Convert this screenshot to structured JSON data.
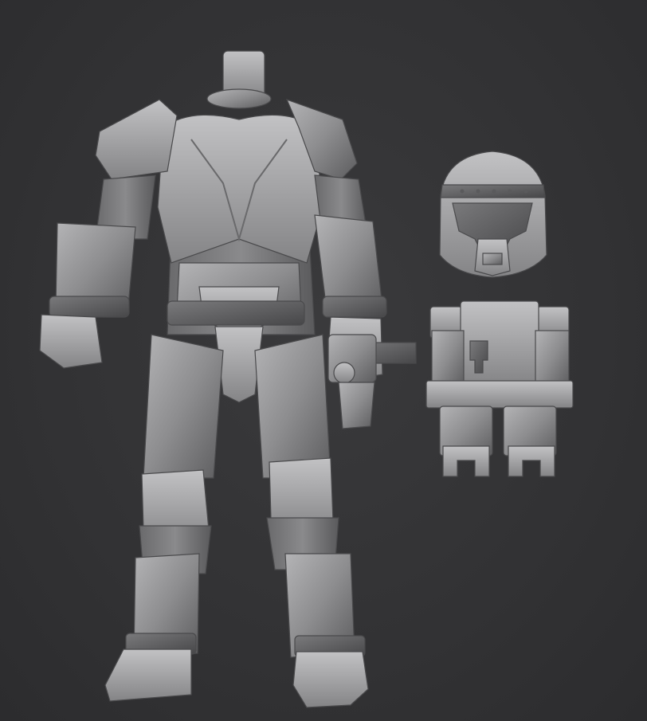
{
  "viewport": {
    "background_color": "#333335",
    "material_color": "#8c8c8c"
  },
  "objects": [
    {
      "name": "armored-body"
    },
    {
      "name": "helmet"
    },
    {
      "name": "backpack"
    }
  ]
}
